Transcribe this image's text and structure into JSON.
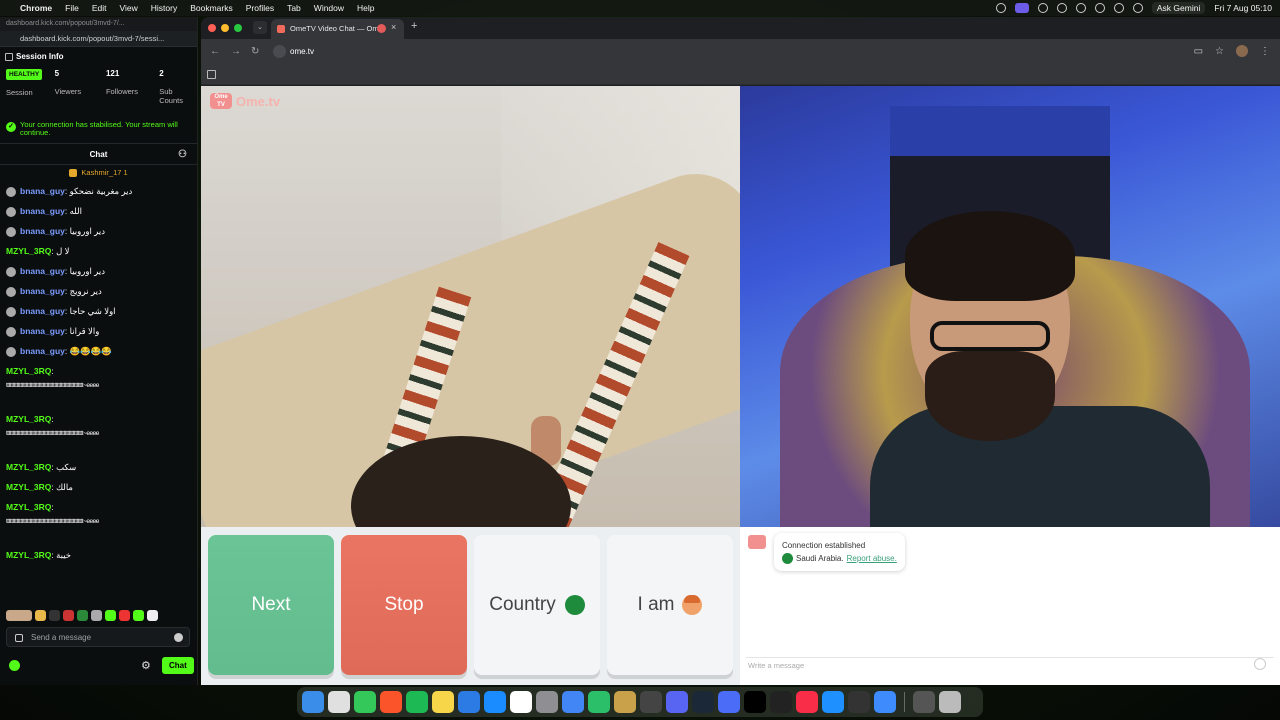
{
  "menubar": {
    "app": "Chrome",
    "items": [
      "File",
      "Edit",
      "View",
      "History",
      "Bookmarks",
      "Profiles",
      "Tab",
      "Window",
      "Help"
    ],
    "ask_gemini": "Ask Gemini",
    "datetime": "Fri 7 Aug 05:10"
  },
  "kick": {
    "url_faded": "dashboard.kick.com/popout/3mvd-7/...",
    "url": "dashboard.kick.com/popout/3mvd-7/sessi...",
    "session_title": "Session Info",
    "stats": {
      "health_badge": "HEALTHY",
      "health_label": "Session",
      "viewers_num": "5",
      "viewers_label": "Viewers",
      "followers_num": "121",
      "followers_label": "Followers",
      "subs_num": "2",
      "subs_label": "Sub Counts"
    },
    "connection_message": "Your connection has stabilised. Your stream will continue.",
    "chat_title": "Chat",
    "pinned_user": "Kashmir_17",
    "pinned_count": "1",
    "messages": [
      {
        "user": "bnana_guy",
        "text": ": دير مغربية نضحكو"
      },
      {
        "user": "bnana_guy",
        "text": ": الله"
      },
      {
        "user": "bnana_guy",
        "text": ": دير اوروبيا"
      },
      {
        "user": "MZYL_3RQ",
        "text": ": لا ل"
      },
      {
        "user": "bnana_guy",
        "text": ": دير اوروبيا"
      },
      {
        "user": "bnana_guy",
        "text": ": دير نرويج"
      },
      {
        "user": "bnana_guy",
        "text": ": اولا شي حاجا"
      },
      {
        "user": "bnana_guy",
        "text": ": والا قرانا"
      },
      {
        "user": "bnana_guy",
        "text": ": 😂😂😂😂"
      },
      {
        "user": "MZYL_3RQ",
        "text": ":",
        "wrap": "ttttttttttttttttttttttttttttttttttttttttttttttttttttttttttt~eeee"
      },
      {
        "user": "MZYL_3RQ",
        "text": ":",
        "wrap": "ttttttttttttttttttttttttttttttttttttttttttttttttttttttttttt~eeee"
      },
      {
        "user": "MZYL_3RQ",
        "text": ": سكب"
      },
      {
        "user": "MZYL_3RQ",
        "text": ": مالك"
      },
      {
        "user": "MZYL_3RQ",
        "text": ":",
        "wrap": "ttttttttttttttttttttttttttttttttttttttttttttttttttttttttttt~eeee"
      },
      {
        "user": "MZYL_3RQ",
        "text": ": خيبة"
      }
    ],
    "send_placeholder": "Send a message",
    "chat_button": "Chat"
  },
  "chrome": {
    "tab_title": "OmeTV Video Chat — Ome",
    "url": "ome.tv"
  },
  "ometv": {
    "logo_badge": "Ome TV",
    "logo_text": "Ome.tv",
    "buttons": {
      "next": "Next",
      "stop": "Stop",
      "country": "Country",
      "iam": "I am"
    },
    "system_message": {
      "line1": "Connection established",
      "country": "Saudi Arabia.",
      "report": "Report abuse."
    },
    "message_placeholder": "Write a message"
  },
  "colors": {
    "kick_green": "#53fc18",
    "next_green": "#62bc8d",
    "stop_red": "#e06a58"
  },
  "dock": {
    "icons": [
      "finder-icon",
      "launchpad-icon",
      "messages-icon",
      "brave-icon",
      "spotify-icon",
      "notes-icon",
      "freeform-icon",
      "appstore-icon",
      "notion-icon",
      "settings-icon",
      "chrome-icon",
      "facetime-icon",
      "stacks-icon",
      "obs-icon",
      "discord-icon",
      "steam-icon",
      "app-icon",
      "tiktok-icon",
      "capcut-icon",
      "music-icon",
      "safari-icon",
      "davinci-icon",
      "xcode-icon",
      "downloads-icon",
      "trash-icon"
    ]
  }
}
